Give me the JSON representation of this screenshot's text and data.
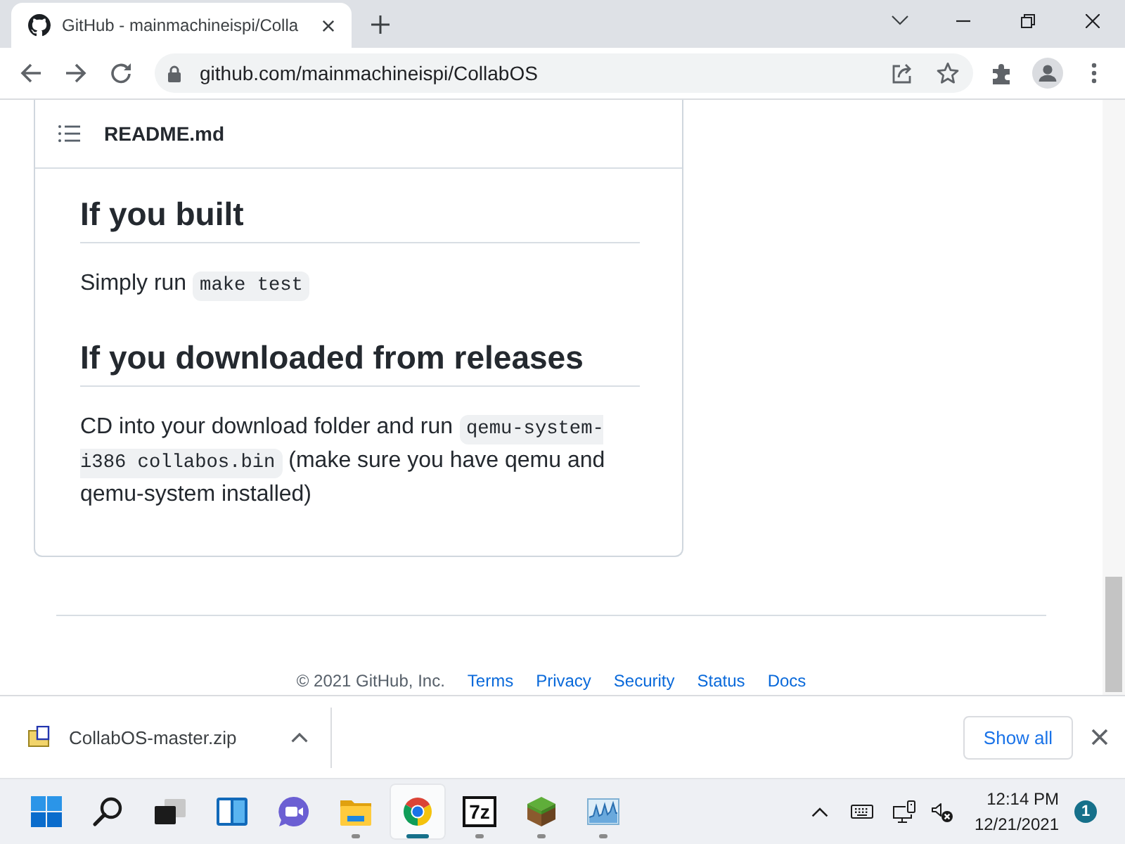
{
  "browser": {
    "tabs": [
      {
        "title": "GitHub - mainmachineispi/Colla",
        "selected": true
      }
    ],
    "address": "github.com/mainmachineispi/CollabOS"
  },
  "readme": {
    "file_name": "README.md",
    "sections": [
      {
        "heading": "If you built",
        "paragraph": [
          {
            "kind": "text",
            "text": "Simply run "
          },
          {
            "kind": "code",
            "text": "make test"
          }
        ]
      },
      {
        "heading": "If you downloaded from releases",
        "paragraph": [
          {
            "kind": "text",
            "text": "CD into your download folder and run "
          },
          {
            "kind": "code",
            "text": "qemu-system-i386 collabos.bin"
          },
          {
            "kind": "text",
            "text": " (make sure you have qemu and qemu-system installed)"
          }
        ]
      }
    ]
  },
  "footer": {
    "copyright": "© 2021 GitHub, Inc.",
    "links": [
      "Terms",
      "Privacy",
      "Security",
      "Status",
      "Docs"
    ]
  },
  "downloads": {
    "items": [
      {
        "file_name": "CollabOS-master.zip"
      }
    ],
    "show_all": "Show all"
  },
  "taskbar": {
    "apps": [
      {
        "kind": "start",
        "running": false,
        "selected": false
      },
      {
        "kind": "search",
        "running": false,
        "selected": false
      },
      {
        "kind": "taskview",
        "running": false,
        "selected": false
      },
      {
        "kind": "widgets",
        "running": false,
        "selected": false
      },
      {
        "kind": "chat",
        "running": false,
        "selected": false
      },
      {
        "kind": "explorer",
        "running": true,
        "selected": false
      },
      {
        "kind": "browser",
        "running": true,
        "selected": true
      },
      {
        "kind": "archiver",
        "label": "7z",
        "running": true,
        "selected": false
      },
      {
        "kind": "game",
        "running": true,
        "selected": false
      },
      {
        "kind": "monitor",
        "running": true,
        "selected": false
      }
    ],
    "clock": {
      "time": "12:14 PM",
      "date": "12/21/2021"
    },
    "notifications": "1"
  }
}
